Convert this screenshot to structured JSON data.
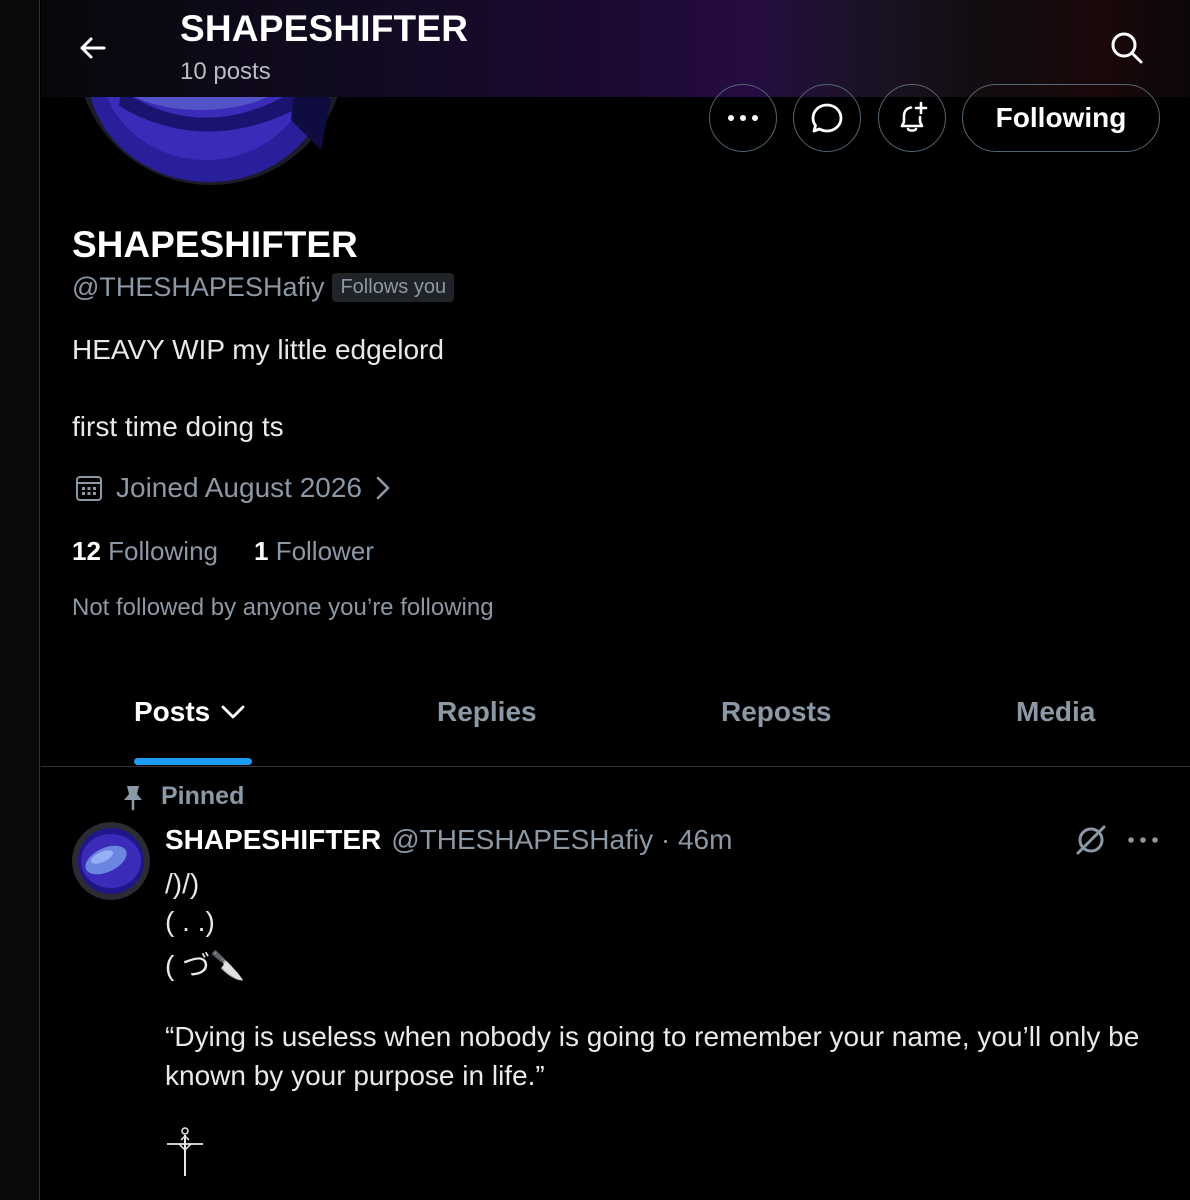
{
  "header": {
    "title": "SHAPESHIFTER",
    "post_count": "10 posts",
    "back_icon": "arrow-left-icon",
    "search_icon": "search-icon"
  },
  "actions": {
    "more_icon": "more-icon",
    "message_icon": "message-icon",
    "notify_icon": "bell-plus-icon",
    "following_label": "Following"
  },
  "profile": {
    "name": "SHAPESHIFTER",
    "handle": "@THESHAPESHafiy",
    "follows_you": "Follows you",
    "bio_line1": "HEAVY WIP my little edgelord",
    "bio_line2": "first time doing ts",
    "joined": "Joined August 2026",
    "following_count": "12",
    "following_label": "Following",
    "followers_count": "1",
    "followers_label": "Follower",
    "not_followed": "Not followed by anyone you’re following"
  },
  "tabs": [
    {
      "label": "Posts",
      "active": true
    },
    {
      "label": "Replies",
      "active": false
    },
    {
      "label": "Reposts",
      "active": false
    },
    {
      "label": "Media",
      "active": false
    }
  ],
  "post": {
    "pinned_label": "Pinned",
    "author_name": "SHAPESHIFTER",
    "author_meta": "@THESHAPESHafiy · 46m",
    "line1": "/)/)",
    "line2": "( . .)",
    "line3": "( づ🔪",
    "quote": "“Dying is useless when nobody is going to remember your name, you’ll only be known by your purpose in life.”"
  },
  "colors": {
    "accent": "#1d9bf0",
    "secondary_text": "#8b98a5",
    "border": "#536471",
    "avatar_blue": "#3a2bb8"
  }
}
